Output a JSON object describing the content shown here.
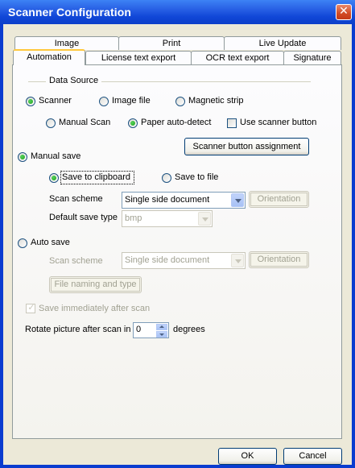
{
  "window": {
    "title": "Scanner Configuration",
    "close_glyph": "✕"
  },
  "tabs_row1": [
    {
      "label": "Image"
    },
    {
      "label": "Print"
    },
    {
      "label": "Live Update"
    }
  ],
  "tabs_row2": [
    {
      "label": "Automation",
      "selected": true
    },
    {
      "label": "License text export"
    },
    {
      "label": "OCR text export"
    },
    {
      "label": "Signature"
    }
  ],
  "data_source": {
    "title": "Data Source",
    "sources": [
      {
        "label": "Scanner",
        "checked": true
      },
      {
        "label": "Image file",
        "checked": false
      },
      {
        "label": "Magnetic strip",
        "checked": false
      }
    ],
    "scan_modes": [
      {
        "label": "Manual Scan",
        "checked": false
      },
      {
        "label": "Paper auto-detect",
        "checked": true
      }
    ],
    "use_scanner_button": {
      "label": "Use scanner button",
      "checked": false
    }
  },
  "scanner_button_assignment_label": "Scanner button assignment",
  "manual_save": {
    "label": "Manual save",
    "checked": true,
    "targets": [
      {
        "label": "Save to clipboard",
        "checked": true
      },
      {
        "label": "Save to file",
        "checked": false
      }
    ],
    "scan_scheme_label": "Scan scheme",
    "scan_scheme_value": "Single side document",
    "orientation_label": "Orientation",
    "default_save_type_label": "Default save type",
    "default_save_type_value": "bmp"
  },
  "auto_save": {
    "label": "Auto save",
    "checked": false,
    "scan_scheme_label": "Scan scheme",
    "scan_scheme_value": "Single side document",
    "orientation_label": "Orientation",
    "file_naming_label": "File naming and type"
  },
  "save_immediately": {
    "label": "Save immediately after scan",
    "checked": true
  },
  "rotate": {
    "label": "Rotate picture after scan in",
    "value": "0",
    "unit": "degrees"
  },
  "footer": {
    "ok_label": "OK",
    "cancel_label": "Cancel"
  }
}
